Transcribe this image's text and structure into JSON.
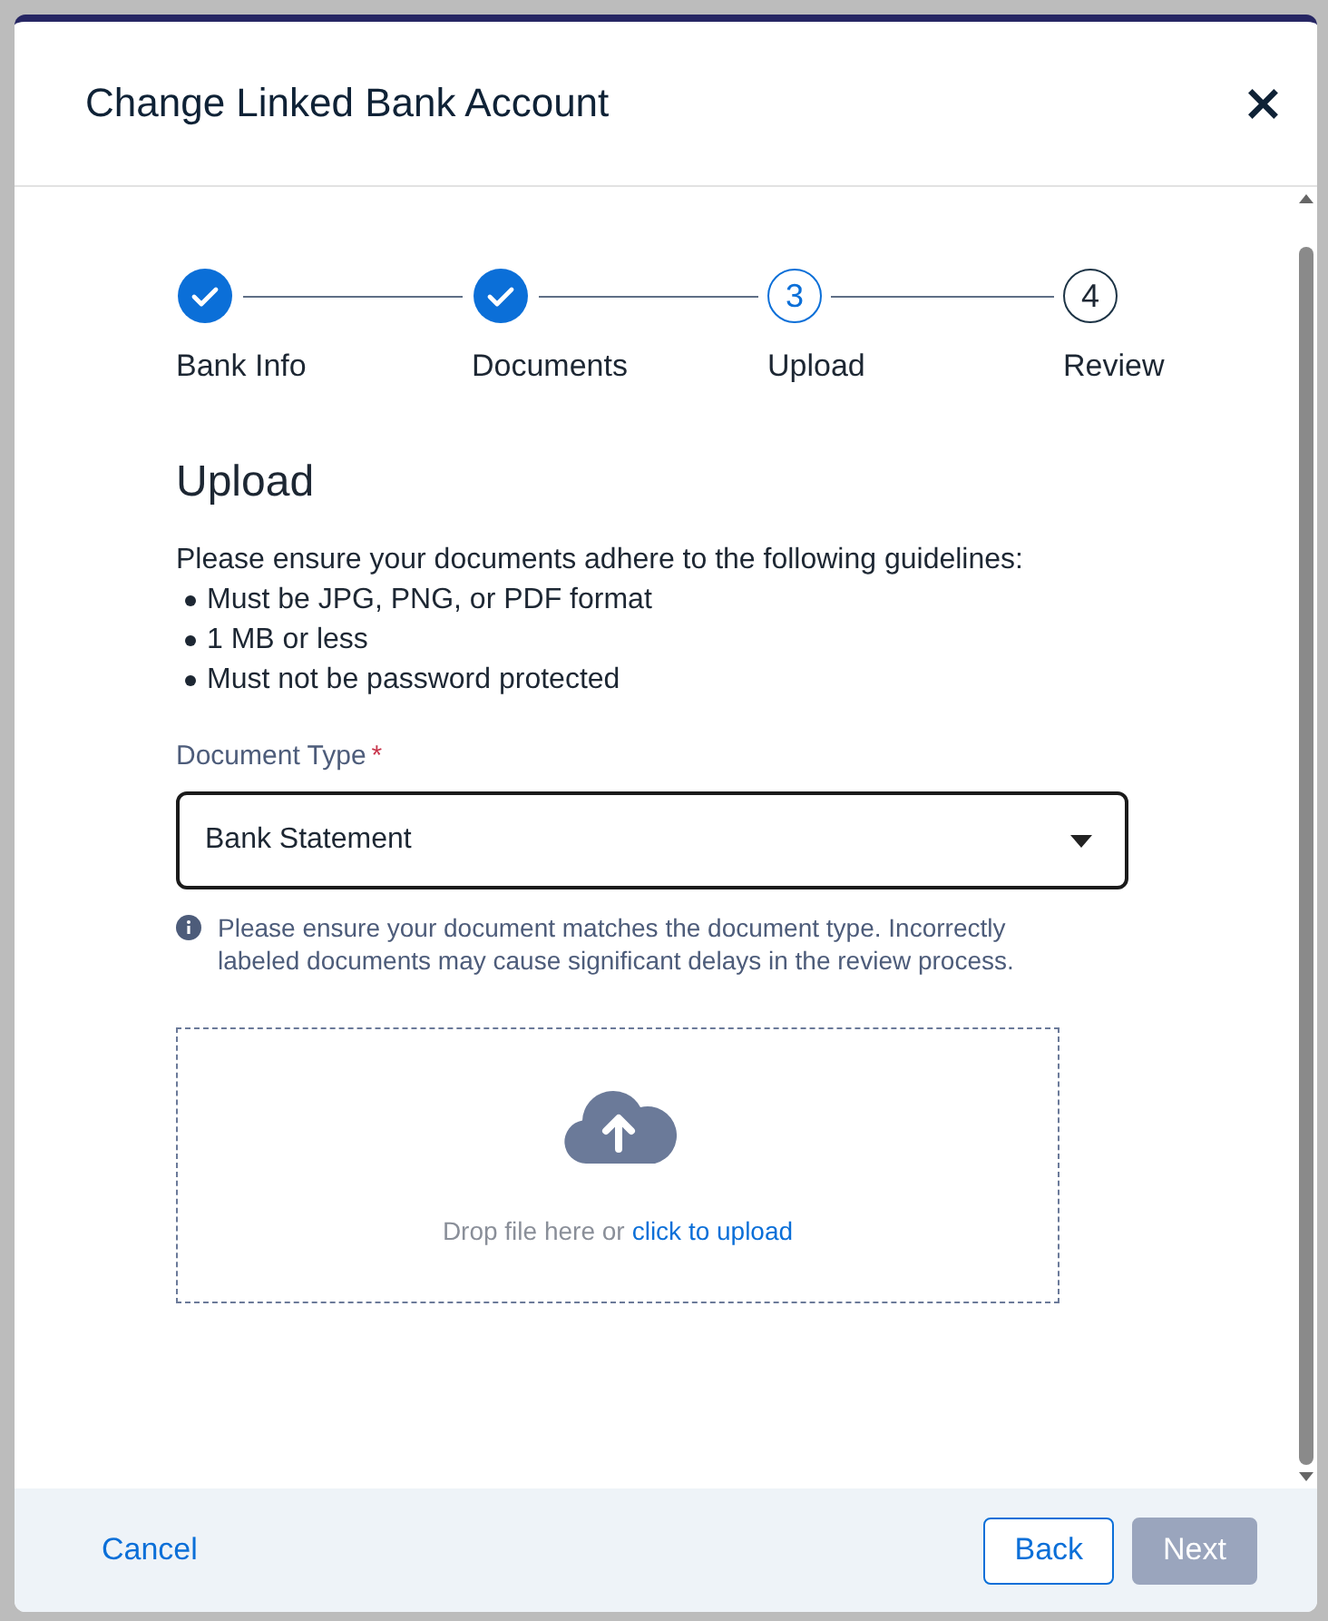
{
  "dialog": {
    "title": "Change Linked Bank Account",
    "close": "×"
  },
  "steps": [
    {
      "label": "Bank Info",
      "kind": "done",
      "selected": false
    },
    {
      "label": "Documents",
      "kind": "done",
      "selected": false
    },
    {
      "label": "Upload",
      "kind": "numbered",
      "number": "3",
      "selected": true
    },
    {
      "label": "Review",
      "kind": "numbered",
      "number": "4",
      "selected": false
    }
  ],
  "section_title": "Upload",
  "guidelines": {
    "intro": "Please ensure your documents adhere to the following guidelines:",
    "items": [
      "Must be JPG, PNG, or PDF format",
      "1 MB or less",
      "Must not be password protected"
    ]
  },
  "document_type": {
    "label": "Document Type",
    "required_mark": "*",
    "value": "Bank Statement"
  },
  "notice": "Please ensure your document matches the document type. Incorrectly labeled documents may cause significant delays in the review process.",
  "upload": {
    "text": "Drop file here or",
    "link": "click to upload"
  },
  "footer": {
    "cancel": "Cancel",
    "back": "Back",
    "next": "Next",
    "next_disabled": true
  }
}
